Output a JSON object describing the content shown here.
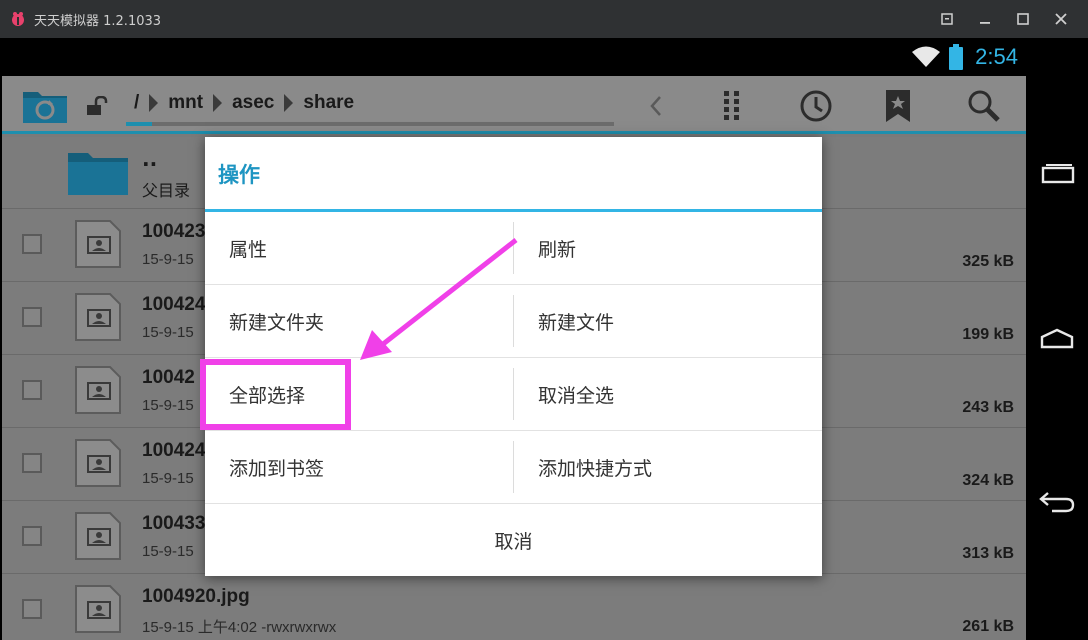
{
  "window": {
    "title": "天天模拟器 1.2.1033"
  },
  "status": {
    "time": "2:54"
  },
  "breadcrumb": [
    "/",
    "mnt",
    "asec",
    "share"
  ],
  "files": {
    "parent": {
      "name": "..",
      "label": "父目录"
    },
    "rows": [
      {
        "name": "100423",
        "meta": "15-9-15",
        "size": "325 kB"
      },
      {
        "name": "100424",
        "meta": "15-9-15",
        "size": "199 kB"
      },
      {
        "name": "10042",
        "meta": "15-9-15",
        "size": "243 kB"
      },
      {
        "name": "100424",
        "meta": "15-9-15",
        "size": "324 kB"
      },
      {
        "name": "100433",
        "meta": "15-9-15",
        "size": "313 kB"
      },
      {
        "name": "1004920.jpg",
        "meta": "15-9-15 上午4:02  -rwxrwxrwx",
        "size": "261 kB"
      }
    ]
  },
  "dialog": {
    "title": "操作",
    "options": [
      {
        "left": "属性",
        "right": "刷新"
      },
      {
        "left": "新建文件夹",
        "right": "新建文件"
      },
      {
        "left": "全部选择",
        "right": "取消全选"
      },
      {
        "left": "添加到书签",
        "right": "添加快捷方式"
      }
    ],
    "cancel": "取消"
  },
  "colors": {
    "accent": "#33b5e5",
    "annotation": "#f040e8"
  }
}
